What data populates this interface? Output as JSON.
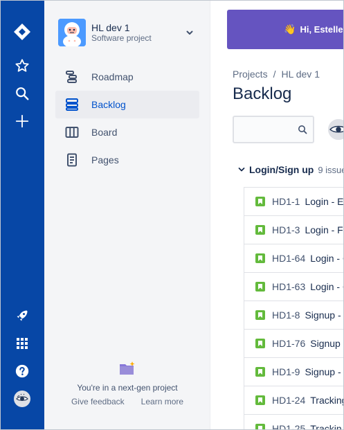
{
  "rail": {
    "icons": [
      "jira-logo-icon",
      "star-icon",
      "search-icon",
      "create-plus-icon",
      "rocket-icon",
      "app-switcher-icon",
      "help-icon",
      "user-avatar"
    ],
    "color": "#0747a6"
  },
  "project": {
    "name": "HL dev 1",
    "type": "Software project"
  },
  "sidebar": {
    "items": [
      {
        "label": "Roadmap",
        "icon": "roadmap-icon",
        "active": false
      },
      {
        "label": "Backlog",
        "icon": "backlog-icon",
        "active": true
      },
      {
        "label": "Board",
        "icon": "board-icon",
        "active": false
      },
      {
        "label": "Pages",
        "icon": "pages-icon",
        "active": false
      }
    ],
    "nextgen_message": "You're in a next-gen project",
    "feedback_label": "Give feedback",
    "learn_more_label": "Learn more"
  },
  "banner": {
    "text": "Hi, Estelle",
    "color": "#6554c0"
  },
  "breadcrumb": {
    "root": "Projects",
    "separator": "/",
    "project": "HL dev 1"
  },
  "page_title": "Backlog",
  "epic_group": {
    "name": "Login/Sign up",
    "count": "9 issue"
  },
  "issues": [
    {
      "key": "HD1-1",
      "summary": "Login - Er"
    },
    {
      "key": "HD1-3",
      "summary": "Login - Fo"
    },
    {
      "key": "HD1-64",
      "summary": "Login - G"
    },
    {
      "key": "HD1-63",
      "summary": "Login - G"
    },
    {
      "key": "HD1-8",
      "summary": "Signup -"
    },
    {
      "key": "HD1-76",
      "summary": "Signup -"
    },
    {
      "key": "HD1-9",
      "summary": "Signup -"
    },
    {
      "key": "HD1-24",
      "summary": "Tracking"
    },
    {
      "key": "HD1-25",
      "summary": "Trackin"
    }
  ],
  "colors": {
    "story": "#63ba3c",
    "active_nav": "#0052cc"
  }
}
